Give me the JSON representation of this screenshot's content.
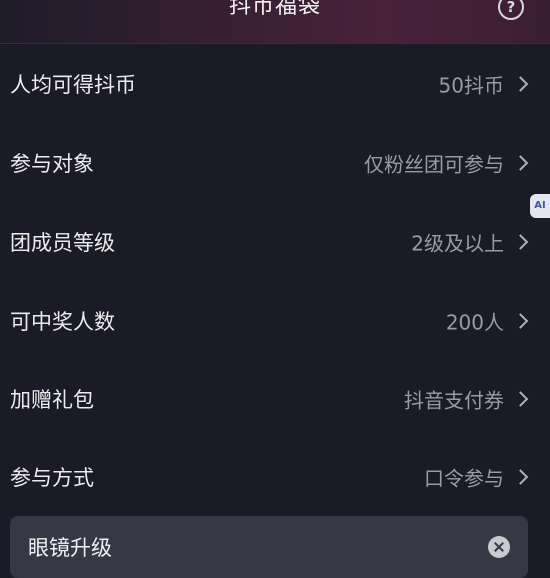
{
  "header": {
    "title": "抖币福袋",
    "help_icon": "help-circle-icon"
  },
  "rows": [
    {
      "label": "人均可得抖币",
      "value": "50抖币"
    },
    {
      "label": "参与对象",
      "value": "仅粉丝团可参与"
    },
    {
      "label": "团成员等级",
      "value": "2级及以上"
    },
    {
      "label": "可中奖人数",
      "value": "200人"
    },
    {
      "label": "加赠礼包",
      "value": "抖音支付券"
    },
    {
      "label": "参与方式",
      "value": "口令参与"
    }
  ],
  "side_tab": {
    "label": "AI"
  },
  "password": {
    "value": "眼镜升级"
  },
  "colors": {
    "background": "#1a1b27",
    "label": "#ececef",
    "value": "#9a9aa6",
    "input_bg": "#373846"
  }
}
